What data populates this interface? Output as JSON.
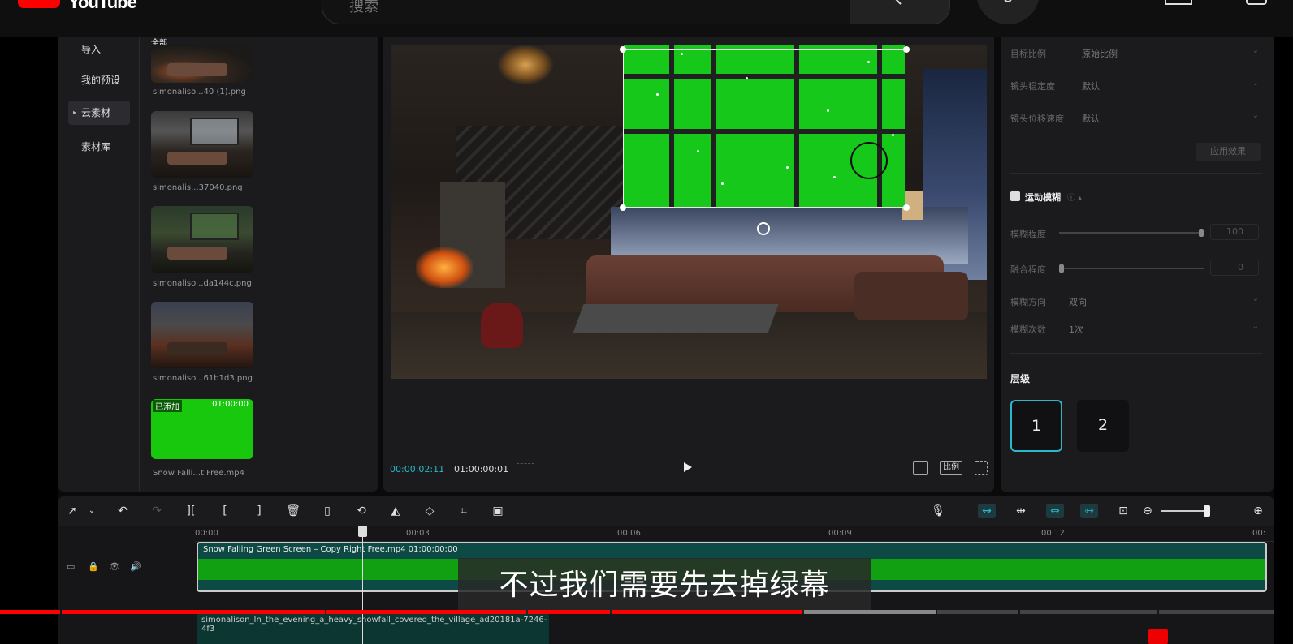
{
  "youtube": {
    "logo_text": "YouTube",
    "search_placeholder": "搜索",
    "progress": {
      "played_fraction": 0.63,
      "buffered_fraction": 0.735
    }
  },
  "editor": {
    "left_nav": {
      "items": [
        {
          "label": "导入"
        },
        {
          "label": "我的预设"
        },
        {
          "label": "云素材",
          "active": true
        },
        {
          "label": "素材库"
        }
      ]
    },
    "media": {
      "filter_label": "全部",
      "items": [
        {
          "name": "simonaliso...40 (1).png"
        },
        {
          "name": "simonalis...37040.png"
        },
        {
          "name": "simonaliso...da144c.png"
        },
        {
          "name": "simonaliso...61b1d3.png"
        },
        {
          "name": "Snow Falli...t Free.mp4",
          "tag": "已添加",
          "duration": "01:00:00"
        }
      ]
    },
    "preview": {
      "current_time": "00:00:02:11",
      "total_time": "01:00:00:01",
      "ratio_label": "比例"
    },
    "properties": {
      "target_ratio": {
        "label": "目标比例",
        "value": "原始比例"
      },
      "stability": {
        "label": "镜头稳定度",
        "value": "默认"
      },
      "move_speed": {
        "label": "镜头位移速度",
        "value": "默认"
      },
      "apply_label": "应用效果",
      "motion_blur": {
        "title": "运动模糊",
        "degree": {
          "label": "模糊程度",
          "value": "100",
          "fraction": 1.0
        },
        "blend": {
          "label": "融合程度",
          "value": "0",
          "fraction": 0.0
        },
        "direction": {
          "label": "模糊方向",
          "value": "双向"
        },
        "times": {
          "label": "模糊次数",
          "value": "1次"
        }
      },
      "layer": {
        "title": "层级",
        "options": [
          "1",
          "2"
        ],
        "selected": "1"
      }
    },
    "timeline": {
      "ruler_labels": [
        "00:00",
        "00:03",
        "00:06",
        "00:09",
        "00:12",
        "00:"
      ],
      "clip_main": {
        "title": "Snow Falling Green Screen – Copy Right Free.mp4",
        "duration": "01:00:00:00"
      },
      "clip_bg": {
        "title": "simonalison_In_the_evening_a_heavy_snowfall_covered_the_village_ad20181a-7246-4f3"
      }
    },
    "subtitle": "不过我们需要先去掉绿幕"
  },
  "colors": {
    "accent": "#2ab8c8",
    "green_screen": "#16c81a",
    "yt_red": "#ff0000"
  }
}
